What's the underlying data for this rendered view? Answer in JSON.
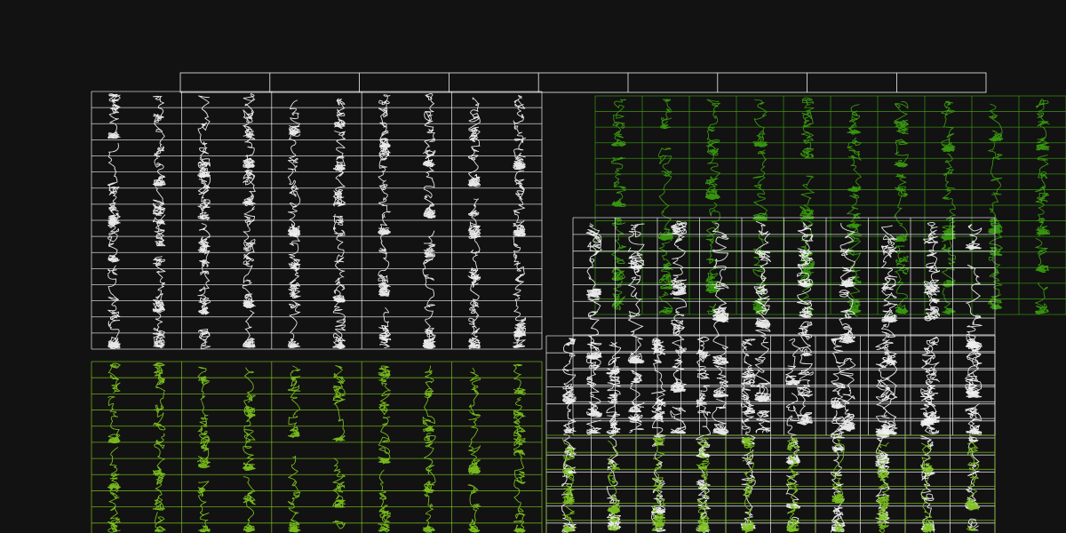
{
  "colors": {
    "background": "#121212",
    "white": "#f2f2f2",
    "lime": "#7cc21e",
    "green": "#3a9c10"
  }
}
